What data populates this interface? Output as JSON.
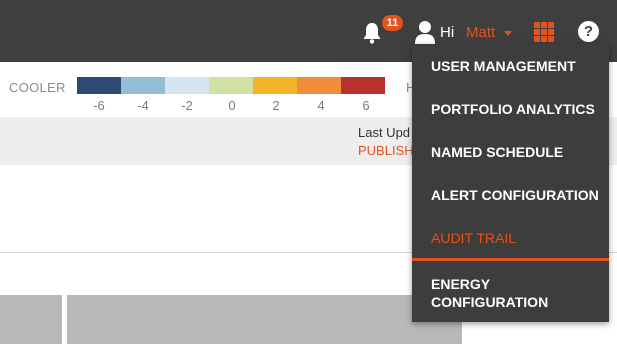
{
  "header": {
    "notification_count": "11",
    "greeting": "Hi",
    "username": "Matt",
    "icons": [
      "bell-icon",
      "user-icon",
      "caret-down-icon",
      "apps-grid-icon",
      "help-icon"
    ],
    "help_glyph": "?"
  },
  "legend": {
    "low_label": "COOLER",
    "high_label": "H",
    "colors": [
      "#2e4a73",
      "#94bdd6",
      "#d5e6f2",
      "#cfe2a2",
      "#f4b329",
      "#f08c3a",
      "#b9312d"
    ],
    "ticks": [
      "-6",
      "-4",
      "-2",
      "0",
      "2",
      "4",
      "6"
    ]
  },
  "status": {
    "last_updated": "Last Upd",
    "publish": "PUBLISH"
  },
  "user_menu": {
    "items": [
      {
        "label": "USER MANAGEMENT"
      },
      {
        "label": "PORTFOLIO ANALYTICS"
      },
      {
        "label": "NAMED SCHEDULE"
      },
      {
        "label": "ALERT CONFIGURATION"
      },
      {
        "label": "AUDIT TRAIL",
        "active": true
      },
      {
        "label": "ENERGY CONFIGURATION"
      }
    ]
  },
  "colors": {
    "accent": "#e1541e",
    "topbar": "#3f3f3f",
    "menu_bg": "#3d3d3d"
  }
}
